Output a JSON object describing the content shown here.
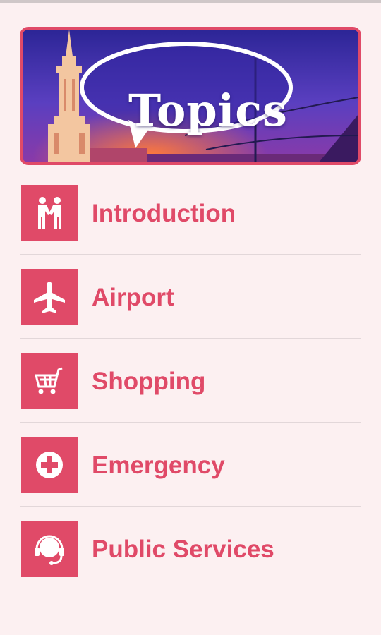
{
  "banner": {
    "title": "Topics",
    "image": "city-monument-at-dusk",
    "border_color": "#e04a68"
  },
  "menu": {
    "accent_color": "#e04a68",
    "items": [
      {
        "label": "Introduction",
        "icon": "handshake-icon"
      },
      {
        "label": "Airport",
        "icon": "airplane-icon"
      },
      {
        "label": "Shopping",
        "icon": "shopping-cart-icon"
      },
      {
        "label": "Emergency",
        "icon": "medical-cross-icon"
      },
      {
        "label": "Public Services",
        "icon": "headset-icon"
      }
    ]
  }
}
